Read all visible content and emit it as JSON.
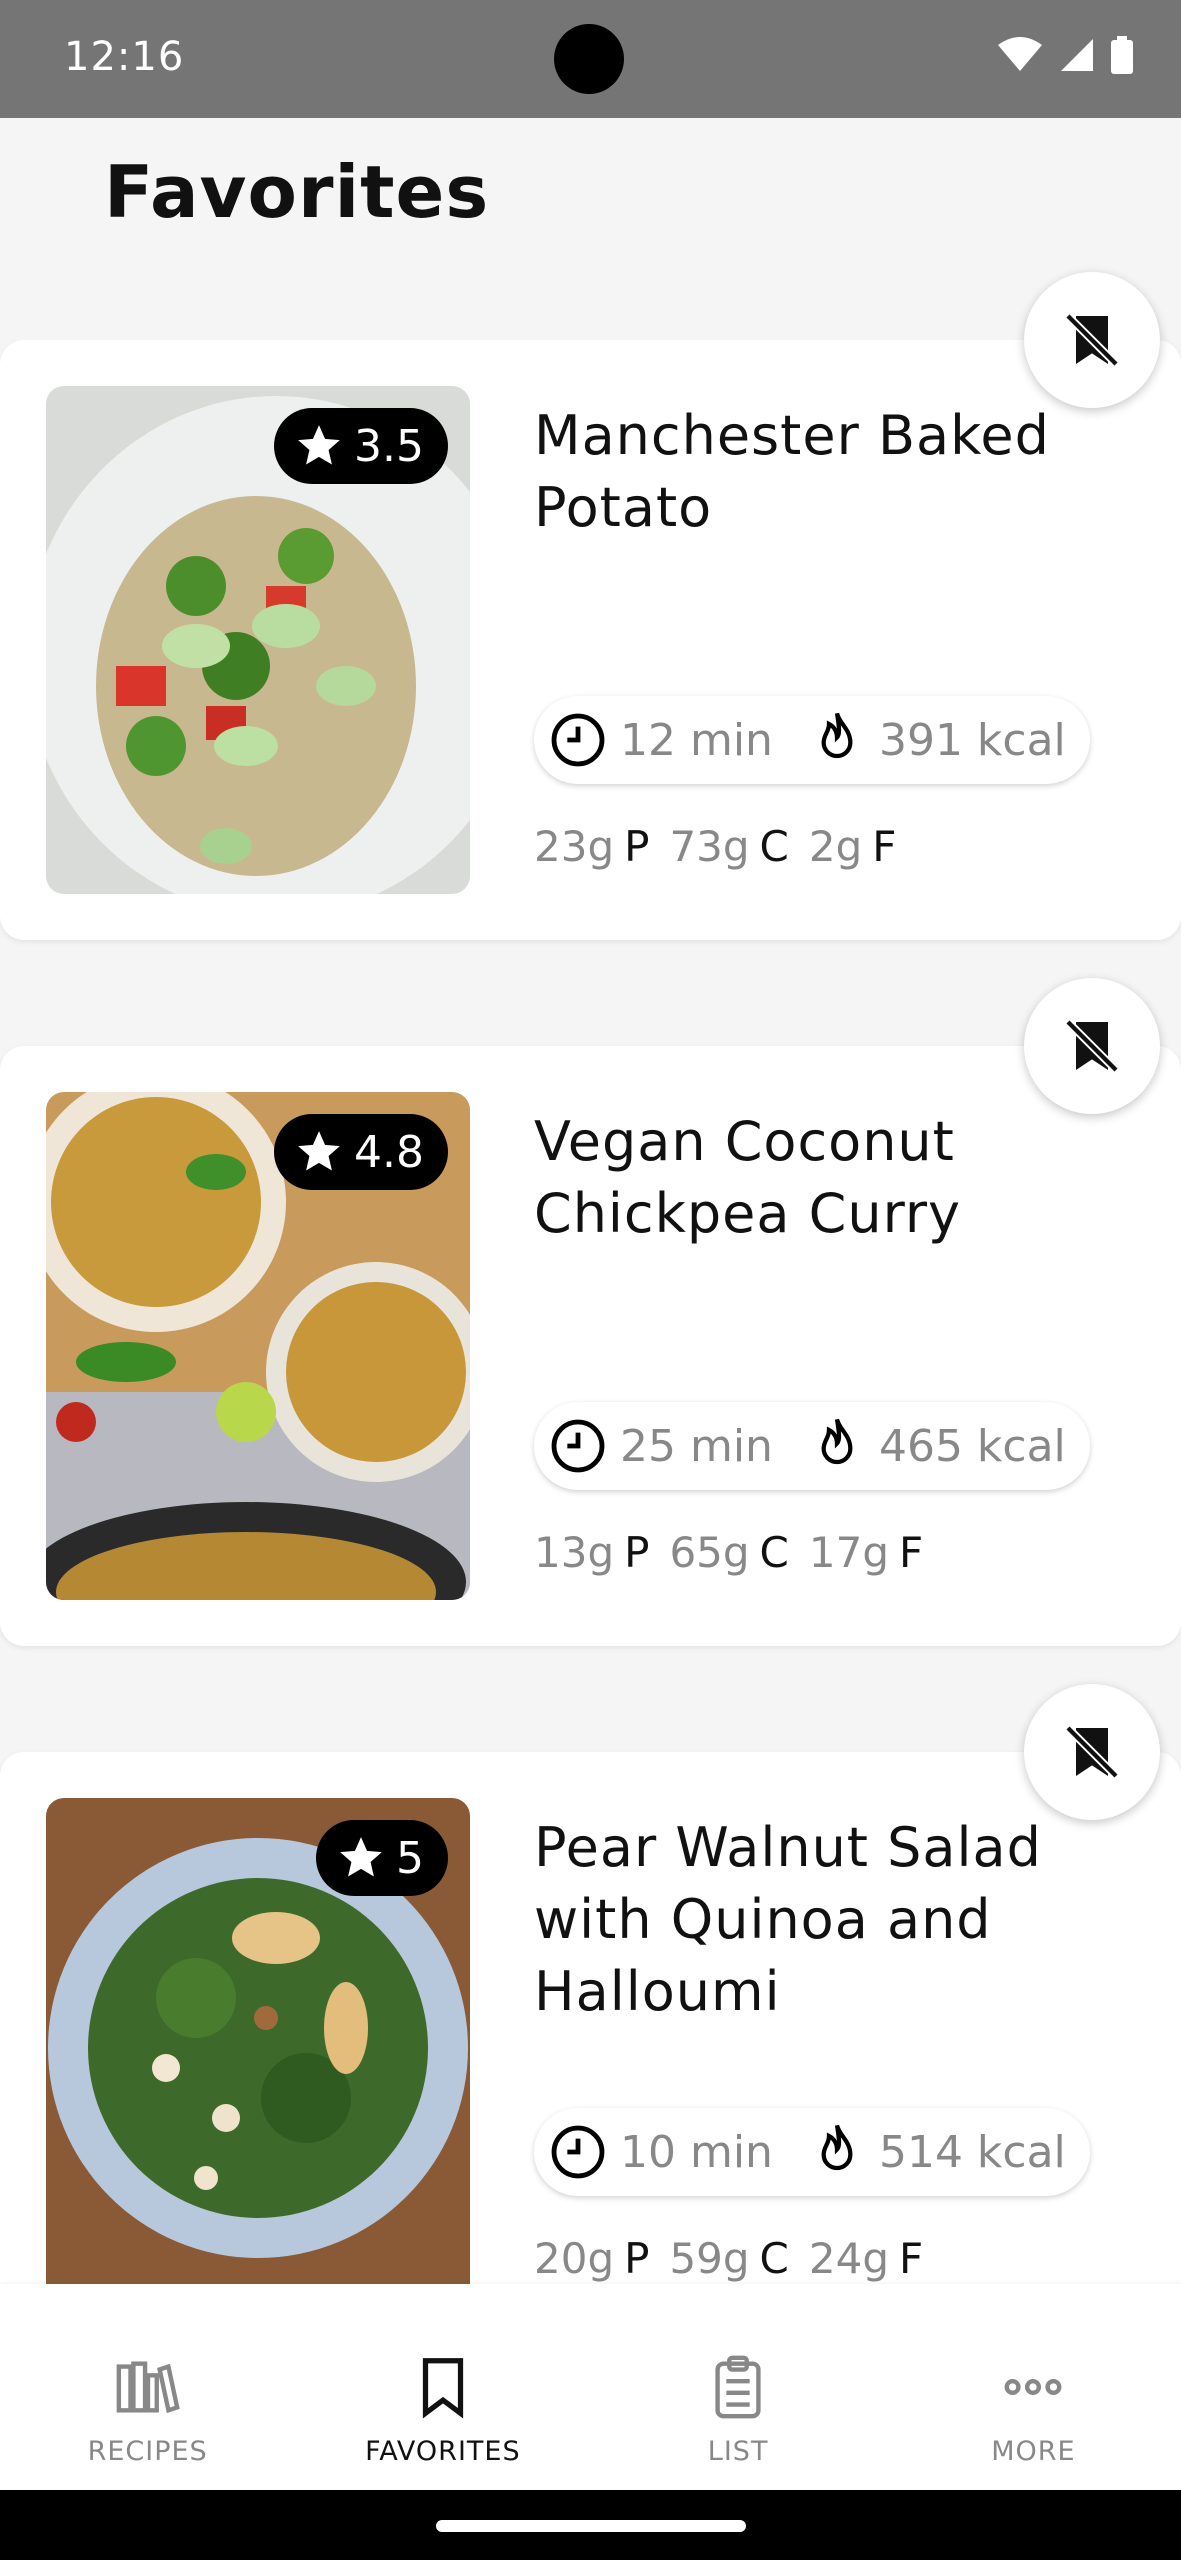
{
  "status_bar": {
    "time": "12:16"
  },
  "header": {
    "title": "Favorites"
  },
  "recipes": [
    {
      "title": "Manchester Baked Potato",
      "rating": "3.5",
      "time": "12 min",
      "kcal": "391 kcal",
      "protein": "23g",
      "carbs": "73g",
      "fat": "2g"
    },
    {
      "title": "Vegan Coconut Chickpea Curry",
      "rating": "4.8",
      "time": "25 min",
      "kcal": "465 kcal",
      "protein": "13g",
      "carbs": "65g",
      "fat": "17g"
    },
    {
      "title": "Pear Walnut Salad with Quinoa and Halloumi",
      "rating": "5",
      "time": "10 min",
      "kcal": "514 kcal",
      "protein": "20g",
      "carbs": "59g",
      "fat": "24g"
    }
  ],
  "macro_units": {
    "protein": "P",
    "carbs": "C",
    "fat": "F"
  },
  "bottom_nav": {
    "items": [
      {
        "label": "RECIPES",
        "icon": "books-icon",
        "active": false
      },
      {
        "label": "FAVORITES",
        "icon": "bookmark-icon",
        "active": true
      },
      {
        "label": "LIST",
        "icon": "clipboard-list-icon",
        "active": false
      },
      {
        "label": "MORE",
        "icon": "more-dots-icon",
        "active": false
      }
    ]
  },
  "colors": {
    "accent": "#111111",
    "muted": "#888888",
    "status_bar": "#757575"
  }
}
